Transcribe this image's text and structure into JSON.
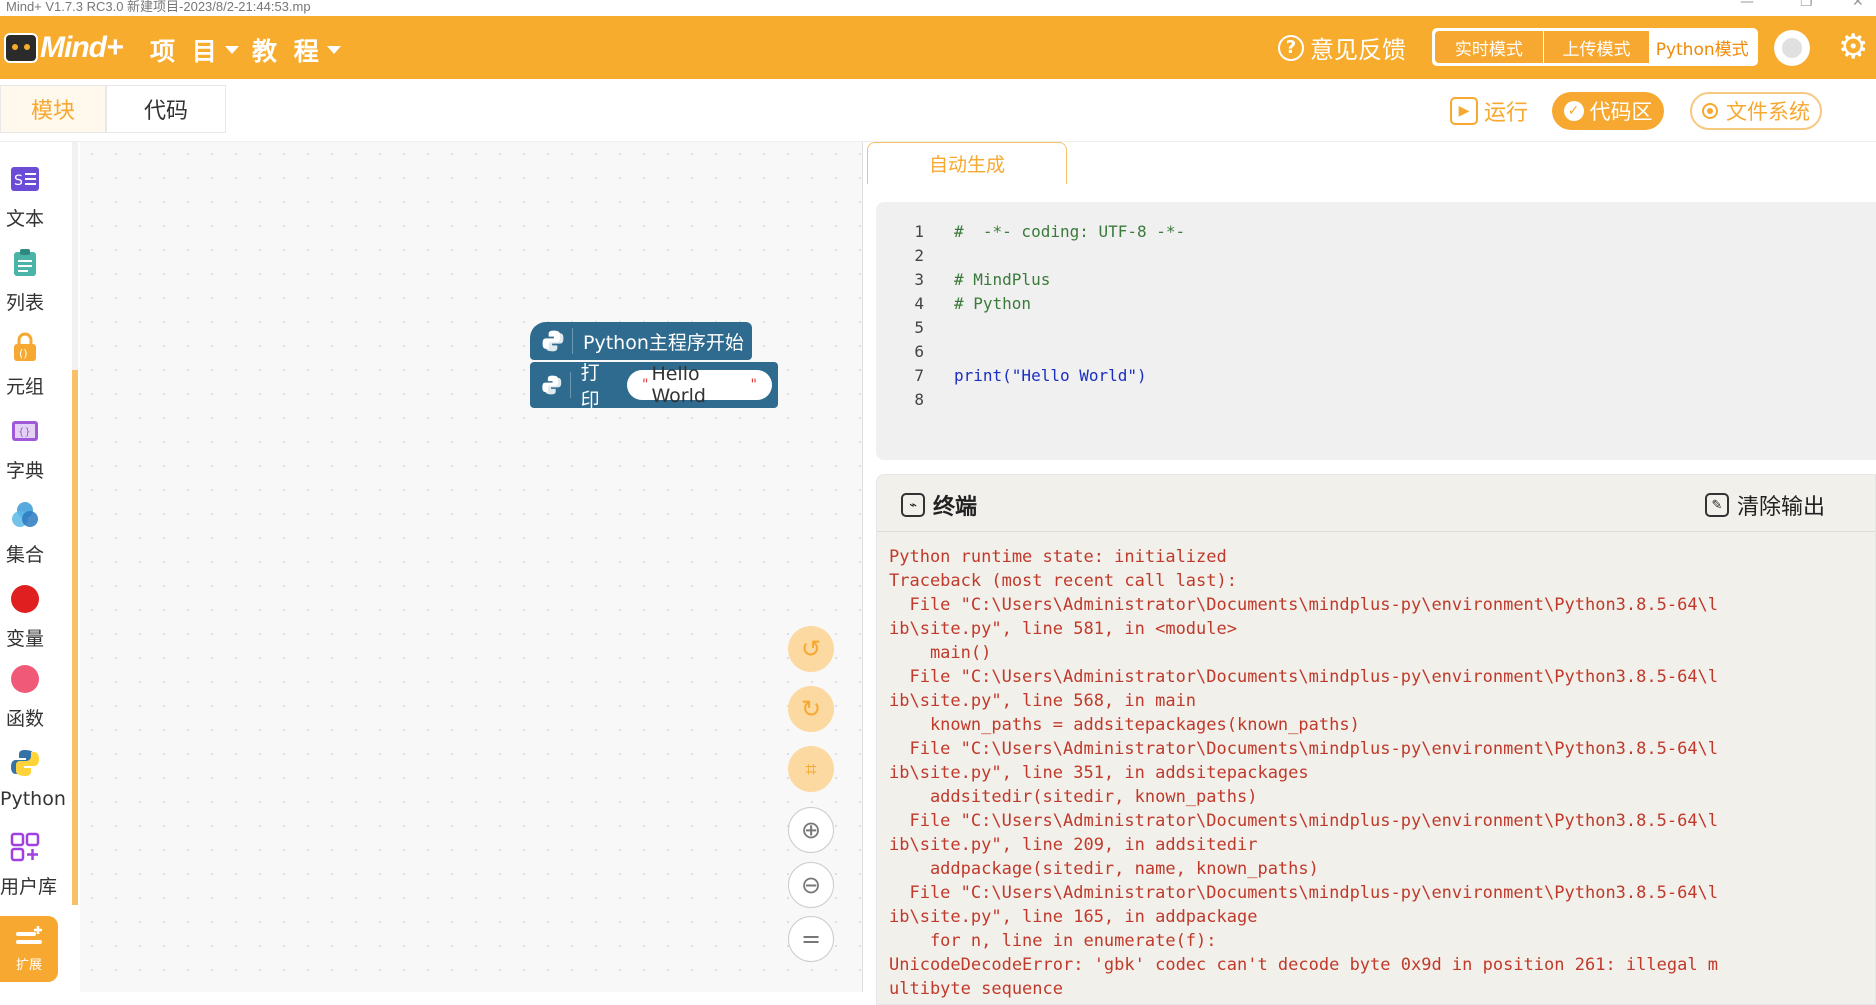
{
  "window": {
    "title": "Mind+ V1.7.3 RC3.0   新建项目-2023/8/2-21:44:53.mp"
  },
  "topbar": {
    "logo_text": "Mind+",
    "menu_project": "项 目",
    "menu_tutorial": "教 程",
    "feedback": "意见反馈",
    "modes": [
      "实时模式",
      "上传模式",
      "Python模式"
    ],
    "selected_mode": "Python模式",
    "accent_color": "#f7ac2e"
  },
  "tabs": {
    "blocks": "模块",
    "code": "代码",
    "active": "模块"
  },
  "toolbar": {
    "run": "运行",
    "code_area": "代码区",
    "file_system": "文件系统"
  },
  "sidebar": {
    "items": [
      {
        "label": "文本",
        "icon": "text-icon",
        "color": "#6a4cd6"
      },
      {
        "label": "列表",
        "icon": "list-icon",
        "color": "#4cb3a8"
      },
      {
        "label": "元组",
        "icon": "tuple-icon",
        "color": "#f7a830"
      },
      {
        "label": "字典",
        "icon": "dict-icon",
        "color": "#a05ad8"
      },
      {
        "label": "集合",
        "icon": "set-icon",
        "color": "#3a9ad8"
      },
      {
        "label": "变量",
        "icon": "variable-icon",
        "color": "#e02020"
      },
      {
        "label": "函数",
        "icon": "function-icon",
        "color": "#f05a78"
      },
      {
        "label": "Python",
        "icon": "python-icon",
        "color": "#3572a5"
      },
      {
        "label": "用户库",
        "icon": "user-library-icon",
        "color": "#a040e0"
      }
    ],
    "extension": "扩展"
  },
  "workspace": {
    "block_main": "Python主程序开始",
    "block_print": "打印",
    "block_print_value": "Hello World"
  },
  "code_panel": {
    "tab": "自动生成",
    "lines": [
      {
        "n": "1",
        "text": "#  -*- coding: UTF-8 -*-"
      },
      {
        "n": "2",
        "text": ""
      },
      {
        "n": "3",
        "text": "# MindPlus"
      },
      {
        "n": "4",
        "text": "# Python"
      },
      {
        "n": "5",
        "text": ""
      },
      {
        "n": "6",
        "text": ""
      },
      {
        "n": "7",
        "text": "print(\"Hello World\")"
      },
      {
        "n": "8",
        "text": ""
      }
    ]
  },
  "terminal": {
    "title": "终端",
    "clear": "清除输出",
    "output": [
      "Python runtime state: initialized",
      "Traceback (most recent call last):",
      "  File \"C:\\Users\\Administrator\\Documents\\mindplus-py\\environment\\Python3.8.5-64\\l",
      "ib\\site.py\", line 581, in <module>",
      "    main()",
      "  File \"C:\\Users\\Administrator\\Documents\\mindplus-py\\environment\\Python3.8.5-64\\l",
      "ib\\site.py\", line 568, in main",
      "    known_paths = addsitepackages(known_paths)",
      "  File \"C:\\Users\\Administrator\\Documents\\mindplus-py\\environment\\Python3.8.5-64\\l",
      "ib\\site.py\", line 351, in addsitepackages",
      "    addsitedir(sitedir, known_paths)",
      "  File \"C:\\Users\\Administrator\\Documents\\mindplus-py\\environment\\Python3.8.5-64\\l",
      "ib\\site.py\", line 209, in addsitedir",
      "    addpackage(sitedir, name, known_paths)",
      "  File \"C:\\Users\\Administrator\\Documents\\mindplus-py\\environment\\Python3.8.5-64\\l",
      "ib\\site.py\", line 165, in addpackage",
      "    for n, line in enumerate(f):",
      "UnicodeDecodeError: 'gbk' codec can't decode byte 0x9d in position 261: illegal m",
      "ultibyte sequence"
    ]
  }
}
